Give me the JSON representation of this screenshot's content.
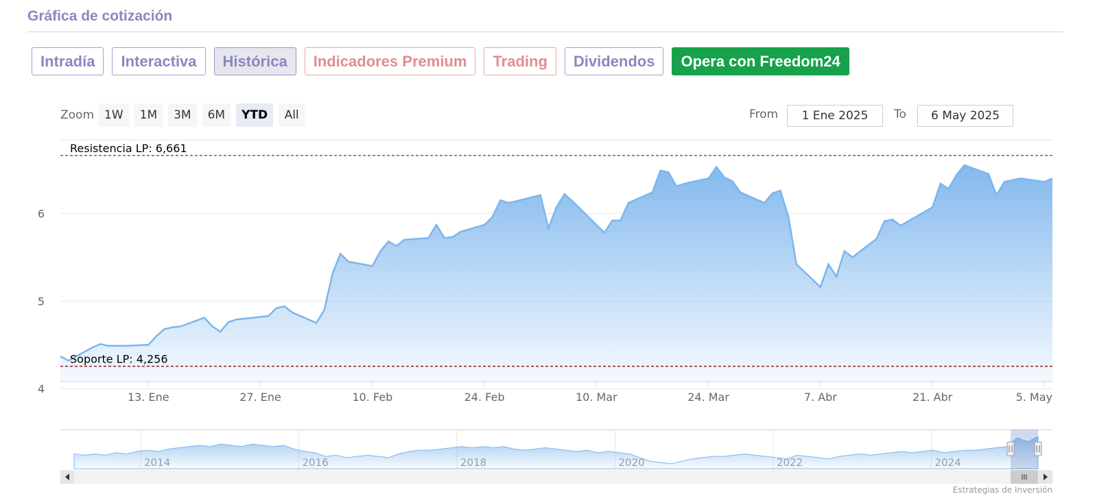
{
  "header": {
    "title": "Gráfica de cotización"
  },
  "tabs": [
    {
      "label": "Intradía",
      "kind": "normal"
    },
    {
      "label": "Interactiva",
      "kind": "normal"
    },
    {
      "label": "Histórica",
      "kind": "active"
    },
    {
      "label": "Indicadores Premium",
      "kind": "premium"
    },
    {
      "label": "Trading",
      "kind": "premium"
    },
    {
      "label": "Dividendos",
      "kind": "normal"
    },
    {
      "label": "Opera con Freedom24",
      "kind": "cta"
    }
  ],
  "range_selector": {
    "zoom_label": "Zoom",
    "buttons": [
      "1W",
      "1M",
      "3M",
      "6M",
      "YTD",
      "All"
    ],
    "selected": "YTD",
    "from_label": "From",
    "from_value": "1 Ene 2025",
    "to_label": "To",
    "to_value": "6 May 2025"
  },
  "credit": "Estrategias de Inversión",
  "colors": {
    "series": "#7cb5ec",
    "resistance": "#2e8b2e",
    "support": "#8b1a1a",
    "cta": "#17a14a"
  },
  "chart_data": {
    "type": "area",
    "y_ticks": [
      4,
      5,
      6
    ],
    "ylim": [
      4.08,
      6.84
    ],
    "x_ticks": [
      "13. Ene",
      "27. Ene",
      "10. Feb",
      "24. Feb",
      "10. Mar",
      "24. Mar",
      "7. Abr",
      "21. Abr",
      "5. May"
    ],
    "x_range": [
      "2025-01-02",
      "2025-05-06"
    ],
    "grid": true,
    "lines": [
      {
        "label": "Resistencia LP: 6,661",
        "value": 6.661,
        "style": "dashed"
      },
      {
        "label": "Soporte LP: 4,256",
        "value": 4.256,
        "style": "dashed"
      }
    ],
    "series": [
      {
        "x": [
          "2025-01-02",
          "2025-01-03",
          "2025-01-06",
          "2025-01-07",
          "2025-01-08",
          "2025-01-09",
          "2025-01-10",
          "2025-01-13",
          "2025-01-14",
          "2025-01-15",
          "2025-01-16",
          "2025-01-17",
          "2025-01-20",
          "2025-01-21",
          "2025-01-22",
          "2025-01-23",
          "2025-01-24",
          "2025-01-27",
          "2025-01-28",
          "2025-01-29",
          "2025-01-30",
          "2025-01-31",
          "2025-02-03",
          "2025-02-04",
          "2025-02-05",
          "2025-02-06",
          "2025-02-07",
          "2025-02-10",
          "2025-02-11",
          "2025-02-12",
          "2025-02-13",
          "2025-02-14",
          "2025-02-17",
          "2025-02-18",
          "2025-02-19",
          "2025-02-20",
          "2025-02-21",
          "2025-02-24",
          "2025-02-25",
          "2025-02-26",
          "2025-02-27",
          "2025-02-28",
          "2025-03-03",
          "2025-03-04",
          "2025-03-05",
          "2025-03-06",
          "2025-03-07",
          "2025-03-10",
          "2025-03-11",
          "2025-03-12",
          "2025-03-13",
          "2025-03-14",
          "2025-03-17",
          "2025-03-18",
          "2025-03-19",
          "2025-03-20",
          "2025-03-21",
          "2025-03-24",
          "2025-03-25",
          "2025-03-26",
          "2025-03-27",
          "2025-03-28",
          "2025-03-31",
          "2025-04-01",
          "2025-04-02",
          "2025-04-03",
          "2025-04-04",
          "2025-04-07",
          "2025-04-08",
          "2025-04-09",
          "2025-04-10",
          "2025-04-11",
          "2025-04-14",
          "2025-04-15",
          "2025-04-16",
          "2025-04-17",
          "2025-04-21",
          "2025-04-22",
          "2025-04-23",
          "2025-04-24",
          "2025-04-25",
          "2025-04-28",
          "2025-04-29",
          "2025-04-30",
          "2025-05-02",
          "2025-05-05",
          "2025-05-06"
        ],
        "values": [
          4.37,
          4.32,
          4.47,
          4.51,
          4.49,
          4.49,
          4.49,
          4.5,
          4.6,
          4.68,
          4.7,
          4.71,
          4.81,
          4.71,
          4.65,
          4.76,
          4.79,
          4.82,
          4.83,
          4.92,
          4.94,
          4.87,
          4.75,
          4.9,
          5.31,
          5.54,
          5.45,
          5.4,
          5.57,
          5.68,
          5.63,
          5.7,
          5.72,
          5.87,
          5.72,
          5.73,
          5.79,
          5.87,
          5.96,
          6.15,
          6.12,
          6.14,
          6.21,
          5.83,
          6.07,
          6.22,
          6.14,
          5.87,
          5.78,
          5.92,
          5.92,
          6.12,
          6.24,
          6.49,
          6.47,
          6.31,
          6.34,
          6.4,
          6.53,
          6.41,
          6.37,
          6.24,
          6.12,
          6.23,
          6.26,
          5.96,
          5.42,
          5.16,
          5.42,
          5.28,
          5.57,
          5.5,
          5.71,
          5.91,
          5.93,
          5.86,
          6.07,
          6.34,
          6.28,
          6.44,
          6.55,
          6.45,
          6.21,
          6.36,
          6.4,
          6.36,
          6.4
        ]
      }
    ]
  },
  "navigator": {
    "year_labels": [
      "2014",
      "2016",
      "2018",
      "2020",
      "2022",
      "2024"
    ],
    "values": [
      5.0,
      4.9,
      5.0,
      4.9,
      5.1,
      5.0,
      5.2,
      5.3,
      5.2,
      5.4,
      5.5,
      5.6,
      5.7,
      5.6,
      5.8,
      5.7,
      5.6,
      5.8,
      5.7,
      5.6,
      5.7,
      5.4,
      5.2,
      5.1,
      4.8,
      4.9,
      4.7,
      4.8,
      4.9,
      4.8,
      4.7,
      5.0,
      5.2,
      5.3,
      5.3,
      5.4,
      5.5,
      5.6,
      5.5,
      5.6,
      5.5,
      5.6,
      5.4,
      5.3,
      5.4,
      5.5,
      5.4,
      5.3,
      5.2,
      5.3,
      5.1,
      5.2,
      5.1,
      5.0,
      4.7,
      4.4,
      4.3,
      4.2,
      4.4,
      4.6,
      4.7,
      4.8,
      4.8,
      4.9,
      5.0,
      4.9,
      4.8,
      4.7,
      4.6,
      4.9,
      4.8,
      4.7,
      4.6,
      4.8,
      4.9,
      5.0,
      4.9,
      5.0,
      5.1,
      5.2,
      5.1,
      5.2,
      5.3,
      5.1,
      5.2,
      5.3,
      5.3,
      5.4,
      5.5,
      5.6,
      6.3,
      6.0,
      6.4
    ]
  }
}
